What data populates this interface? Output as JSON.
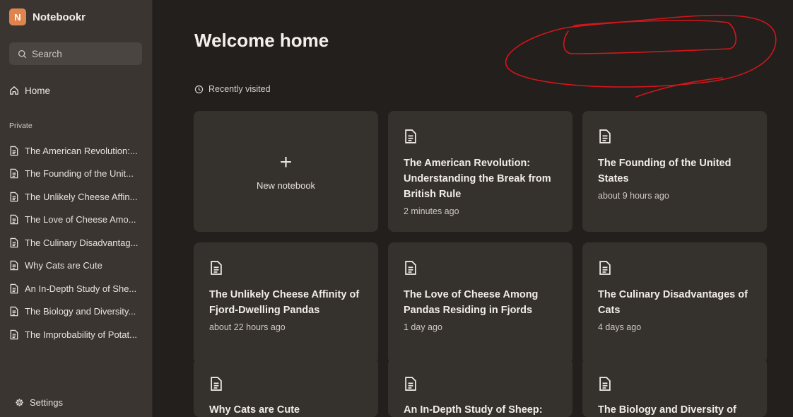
{
  "app": {
    "logo_letter": "N",
    "name": "Notebookr"
  },
  "search": {
    "label": "Search"
  },
  "nav": {
    "home": "Home"
  },
  "sidebar": {
    "section": "Private",
    "items": [
      "The American Revolution:...",
      "The Founding of the Unit...",
      "The Unlikely Cheese Affin...",
      "The Love of Cheese Amo...",
      "The Culinary Disadvantag...",
      "Why Cats are Cute",
      "An In-Depth Study of She...",
      "The Biology and Diversity...",
      "The Improbability of Potat..."
    ],
    "settings": "Settings"
  },
  "main": {
    "title": "Welcome home",
    "recent_label": "Recently visited",
    "new_notebook": "New notebook",
    "cards": [
      {
        "title": "The American Revolution: Understanding the Break from British Rule",
        "time": "2 minutes ago"
      },
      {
        "title": "The Founding of the United States",
        "time": "about 9 hours ago"
      },
      {
        "title": "The Unlikely Cheese Affinity of Fjord-Dwelling Pandas",
        "time": "about 22 hours ago"
      },
      {
        "title": "The Love of Cheese Among Pandas Residing in Fjords",
        "time": "1 day ago"
      },
      {
        "title": "The Culinary Disadvantages of Cats",
        "time": "4 days ago"
      },
      {
        "title": "Why Cats are Cute",
        "time": ""
      },
      {
        "title": "An In-Depth Study of Sheep:",
        "time": ""
      },
      {
        "title": "The Biology and Diversity of",
        "time": ""
      }
    ]
  },
  "icons": {
    "logo": "app-logo",
    "search": "search-icon",
    "home": "home-icon",
    "document": "document-icon",
    "clock": "clock-icon",
    "settings": "gear-icon",
    "plus": "plus-icon"
  },
  "colors": {
    "background": "#221f1c",
    "sidebar": "#3a3531",
    "card": "#35312d",
    "accent": "#e0844f",
    "annotation": "#d4161b"
  }
}
